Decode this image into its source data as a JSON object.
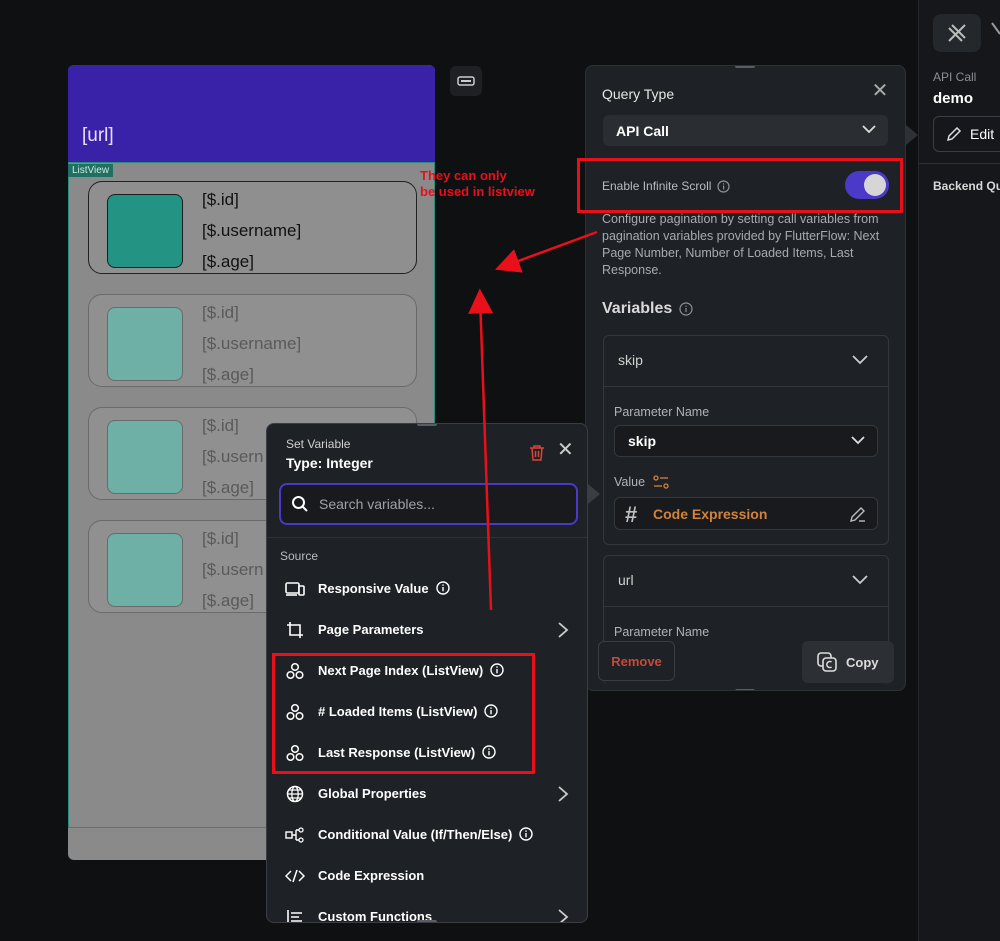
{
  "right_panel": {
    "api_call_label": "API Call",
    "api_name": "demo",
    "edit_label": "Edit",
    "backend_label": "Backend Qu"
  },
  "phone": {
    "app_bar_title": "[url]",
    "listview_tag": "ListView",
    "cards": [
      {
        "id": "[$.id]",
        "username": "[$.username]",
        "age": "[$.age]"
      },
      {
        "id": "[$.id]",
        "username": "[$.username]",
        "age": "[$.age]"
      },
      {
        "id": "[$.id]",
        "username": "[$.usern",
        "age": "[$.age]"
      },
      {
        "id": "[$.id]",
        "username": "[$.usern",
        "age": "[$.age]"
      }
    ]
  },
  "query_panel": {
    "title": "Query Type",
    "query_type": "API Call",
    "infinite_scroll_label": "Enable Infinite Scroll",
    "infinite_scroll_enabled": true,
    "description": "Configure pagination by setting call variables from pagination variables provided by FlutterFlow: Next Page Number, Number of Loaded Items, Last Response.",
    "variables_label": "Variables",
    "variables": [
      {
        "name": "skip",
        "param_label": "Parameter Name",
        "param_value": "skip",
        "value_label": "Value",
        "value_text": "Code Expression"
      },
      {
        "name": "url",
        "param_label": "Parameter Name"
      }
    ],
    "remove_label": "Remove",
    "copy_label": "Copy"
  },
  "set_variable": {
    "title": "Set Variable",
    "type_label": "Type: Integer",
    "search_placeholder": "Search variables...",
    "source_label": "Source",
    "items": [
      {
        "label": "Responsive Value",
        "icon": "responsive-icon"
      },
      {
        "label": "Page Parameters",
        "icon": "page-parameters-icon"
      },
      {
        "label": "Next Page Index (ListView)",
        "icon": "pagination-icon"
      },
      {
        "label": "# Loaded Items (ListView)",
        "icon": "pagination-icon"
      },
      {
        "label": "Last Response (ListView)",
        "icon": "pagination-icon"
      },
      {
        "label": "Global Properties",
        "icon": "globe-icon"
      },
      {
        "label": "Conditional Value (If/Then/Else)",
        "icon": "conditional-icon"
      },
      {
        "label": "Code Expression",
        "icon": "code-icon"
      },
      {
        "label": "Custom Functions",
        "icon": "functions-icon"
      }
    ]
  },
  "annotation": {
    "line1": "They can only",
    "line2": "be used in listview",
    "color": "#e8101a"
  }
}
